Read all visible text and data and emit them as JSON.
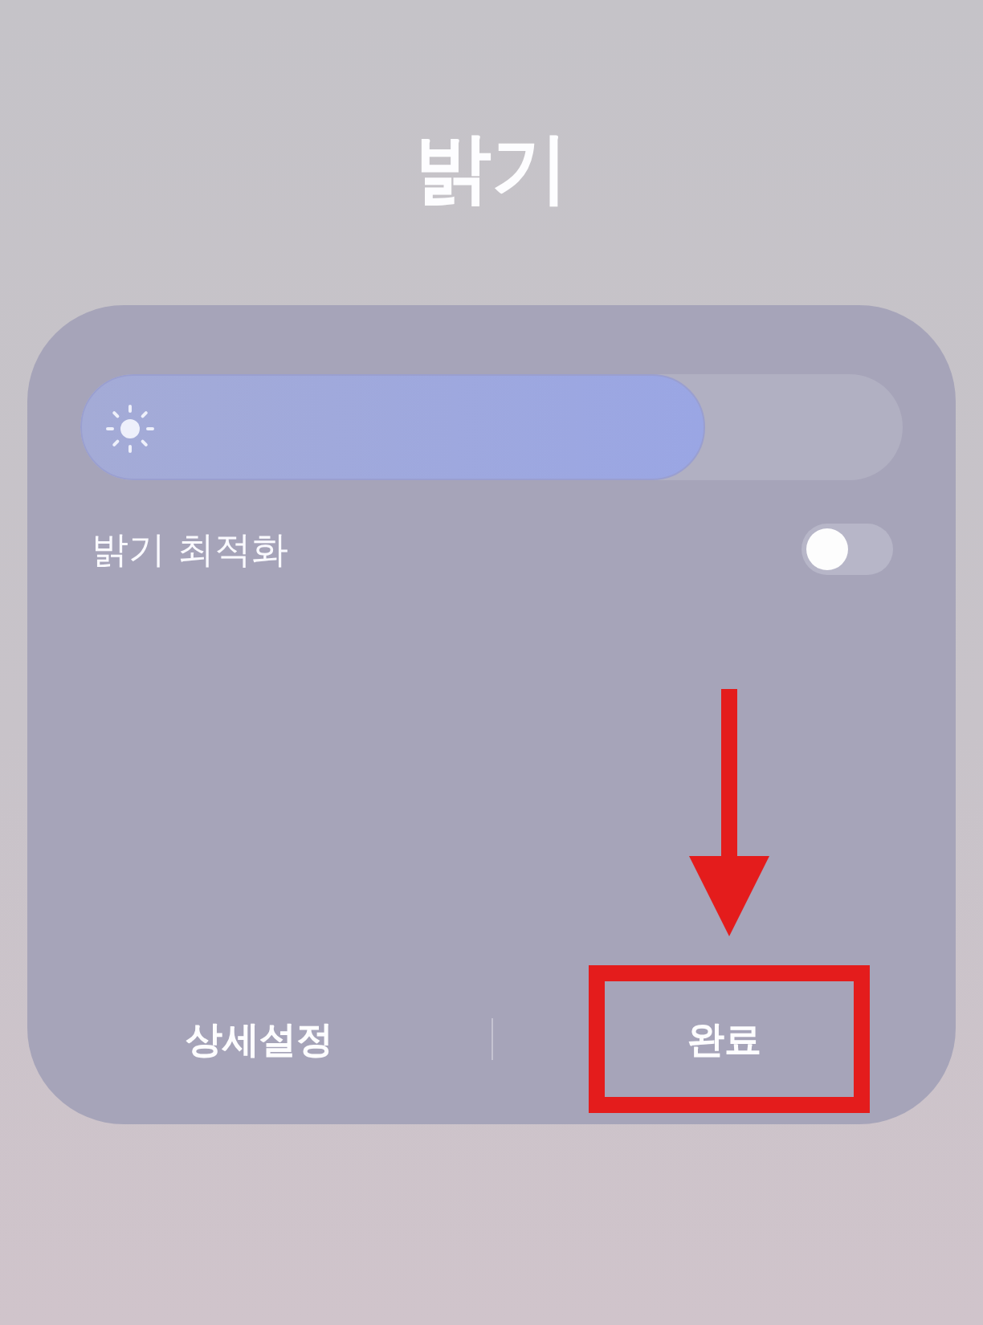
{
  "title": "밝기",
  "brightness": {
    "level": 0.76
  },
  "toggles": [
    {
      "label": "밝기 최적화",
      "on": false
    }
  ],
  "buttons": [
    {
      "label": "상세설정",
      "highlighted": false
    },
    {
      "label": "완료",
      "highlighted": true
    }
  ]
}
